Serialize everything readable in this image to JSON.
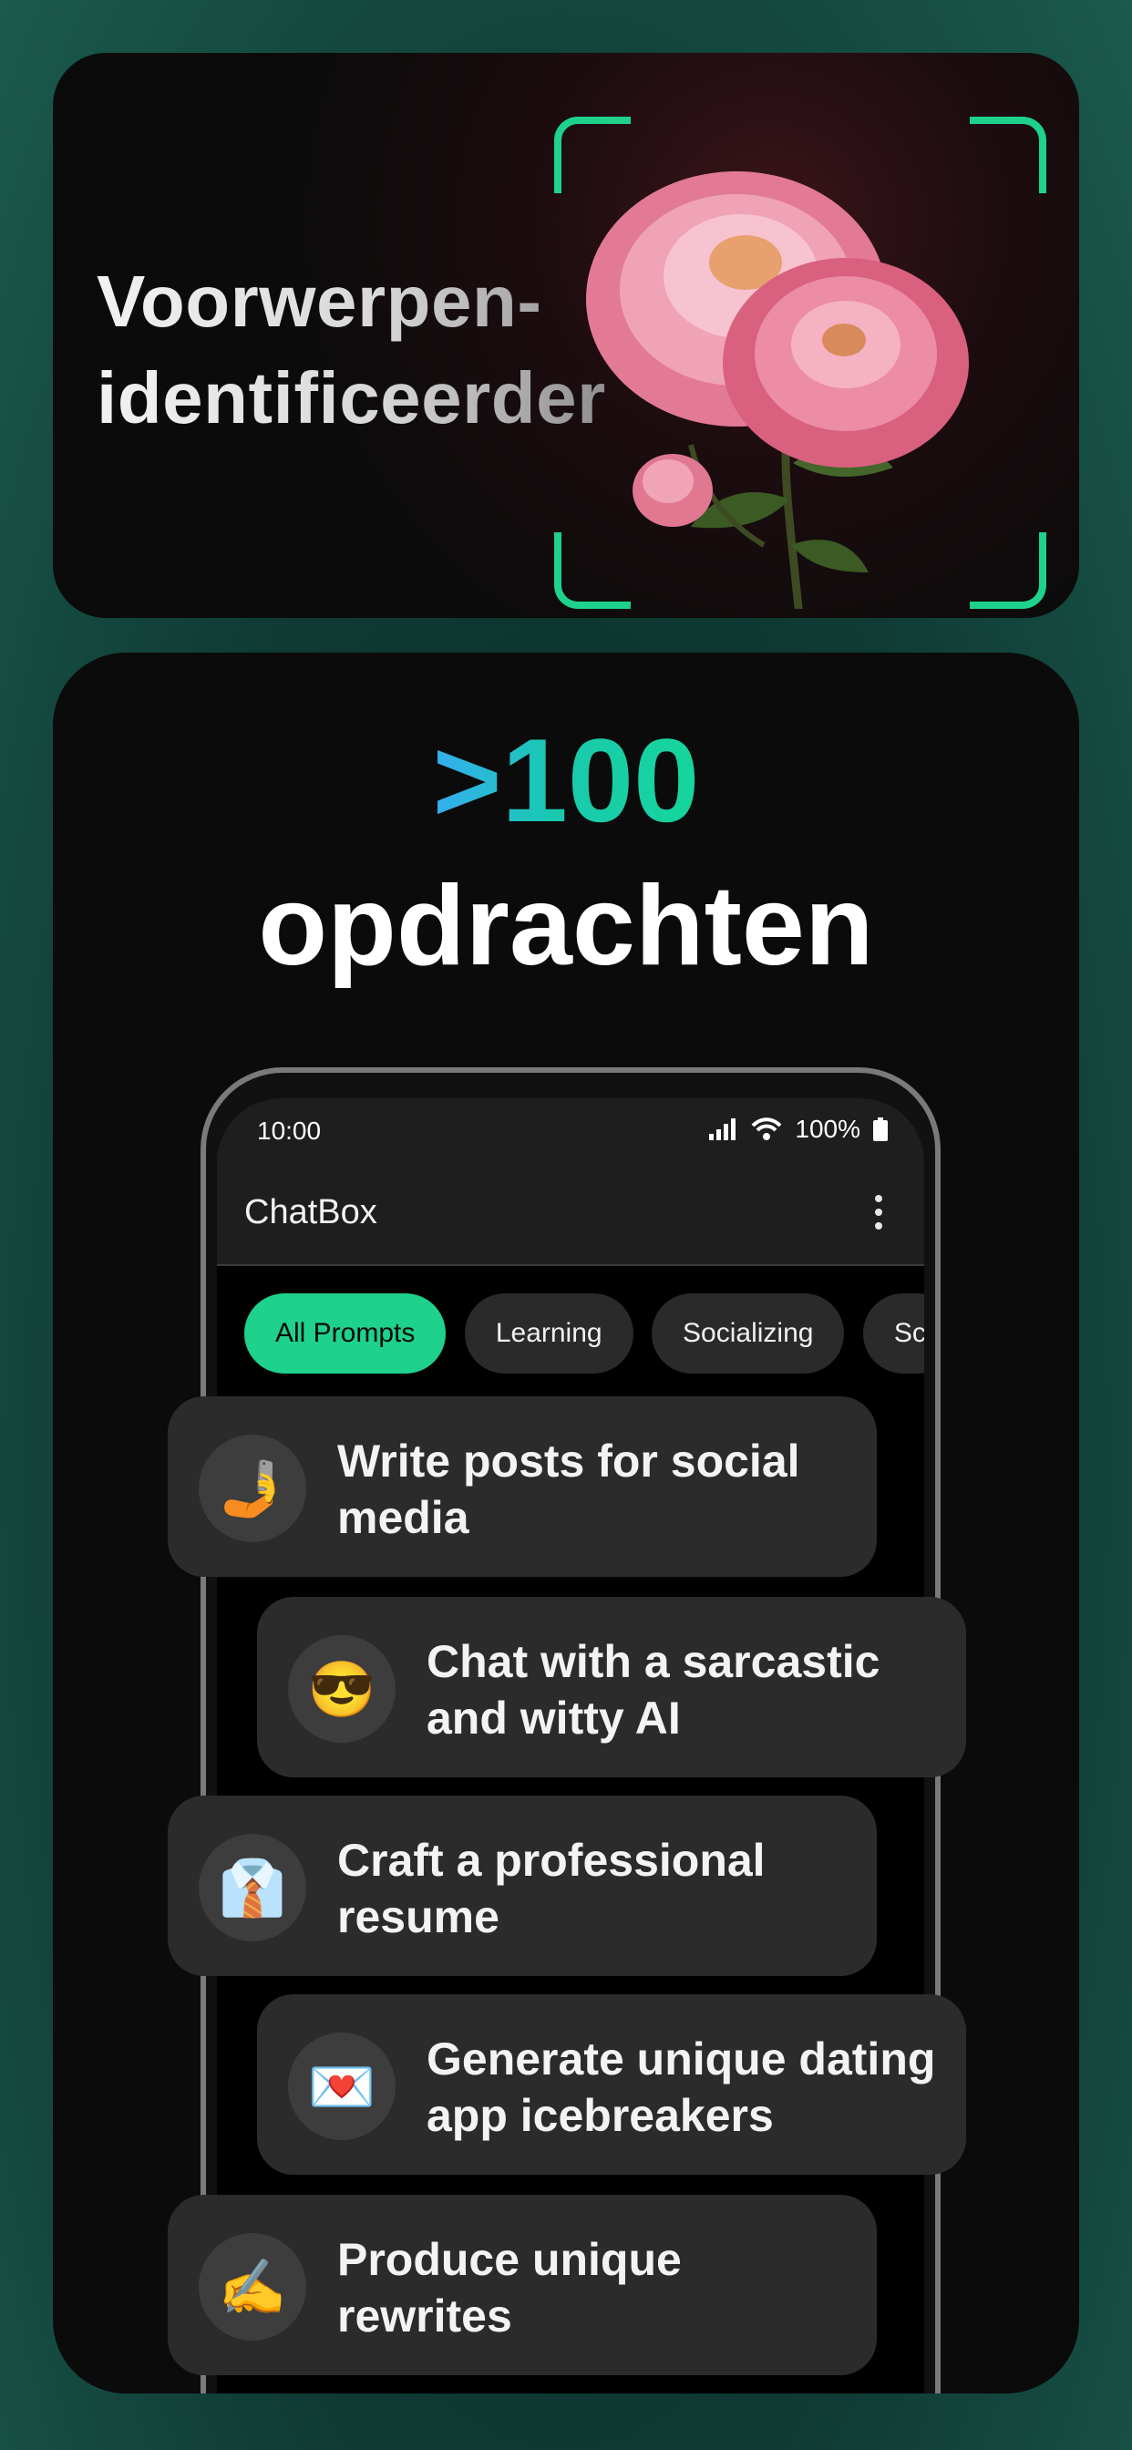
{
  "feature": {
    "title_line1": "Voorwerpen-",
    "title_line2": "identificeerder",
    "accent_color": "#1ed18c"
  },
  "headline": {
    "count": ">100",
    "word": "opdrachten"
  },
  "phone": {
    "status": {
      "time": "10:00",
      "battery": "100%"
    },
    "app_title": "ChatBox",
    "chips": [
      {
        "label": "All Prompts",
        "active": true
      },
      {
        "label": "Learning",
        "active": false
      },
      {
        "label": "Socializing",
        "active": false
      },
      {
        "label": "Sc",
        "active": false
      }
    ]
  },
  "prompts": [
    {
      "icon": "selfie-icon",
      "emoji": "🤳",
      "label": "Write posts for social media"
    },
    {
      "icon": "sunglasses-face-icon",
      "emoji": "😎",
      "label": "Chat with a sarcastic and witty AI"
    },
    {
      "icon": "necktie-icon",
      "emoji": "👔",
      "label": "Craft a professional resume"
    },
    {
      "icon": "love-letter-icon",
      "emoji": "💌",
      "label": "Generate unique dating app icebreakers"
    },
    {
      "icon": "writing-hand-icon",
      "emoji": "✍️",
      "label": "Produce unique rewrites"
    }
  ]
}
